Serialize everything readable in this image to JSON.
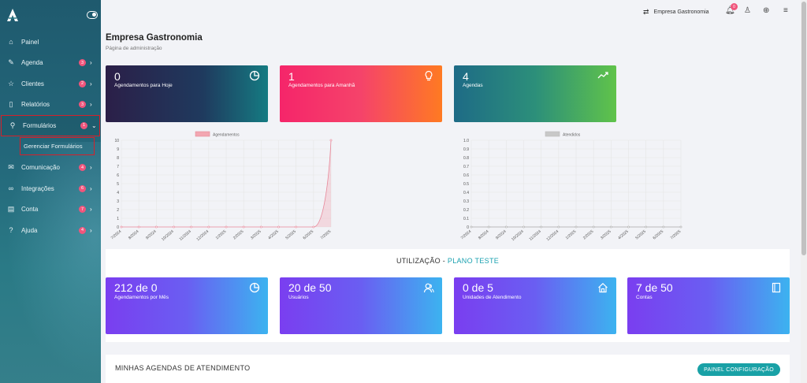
{
  "sidebar": {
    "items": [
      {
        "label": "Painel",
        "icon": "home-icon",
        "badge": "",
        "chevron": ""
      },
      {
        "label": "Agenda",
        "icon": "edit-icon",
        "badge": "3",
        "chevron": "›"
      },
      {
        "label": "Clientes",
        "icon": "star-icon",
        "badge": "2",
        "chevron": "›"
      },
      {
        "label": "Relatórios",
        "icon": "tablet-icon",
        "badge": "3",
        "chevron": "›"
      },
      {
        "label": "Formulários",
        "icon": "search-icon",
        "badge": "1",
        "chevron": "⌄"
      },
      {
        "label": "Comunicação",
        "icon": "mail-icon",
        "badge": "4",
        "chevron": "›"
      },
      {
        "label": "Integrações",
        "icon": "link-icon",
        "badge": "6",
        "chevron": "›"
      },
      {
        "label": "Conta",
        "icon": "briefcase-icon",
        "badge": "7",
        "chevron": "›"
      },
      {
        "label": "Ajuda",
        "icon": "help-icon",
        "badge": "4",
        "chevron": "›"
      }
    ],
    "subitem": "Gerenciar Formulários"
  },
  "topbar": {
    "company": "Empresa Gastronomia",
    "notifications": "0"
  },
  "header": {
    "title": "Empresa Gastronomia",
    "subtitle": "Página de administração"
  },
  "stats": [
    {
      "value": "0",
      "label": "Agendamentos para Hoje",
      "icon": "pie-chart-icon"
    },
    {
      "value": "1",
      "label": "Agendamentos para Amanhã",
      "icon": "lightbulb-icon"
    },
    {
      "value": "4",
      "label": "Agendas",
      "icon": "trend-icon"
    }
  ],
  "chart_data": [
    {
      "type": "area",
      "legend": "Agendamentos",
      "color": "#f3a7b2",
      "categories": [
        "7/2024",
        "8/2024",
        "9/2024",
        "10/2024",
        "11/2024",
        "12/2024",
        "1/2025",
        "2/2025",
        "3/2025",
        "4/2025",
        "5/2025",
        "6/2025",
        "7/2025"
      ],
      "values": [
        0,
        0,
        0,
        0,
        0,
        0,
        0,
        0,
        0,
        0,
        0,
        0,
        10
      ],
      "ylim": [
        0,
        10
      ],
      "yticks": [
        "0",
        "1",
        "2",
        "3",
        "4",
        "5",
        "6",
        "7",
        "8",
        "9",
        "10"
      ],
      "grid": true
    },
    {
      "type": "area",
      "legend": "Atendidos",
      "color": "#c8c8c8",
      "categories": [
        "7/2024",
        "8/2024",
        "9/2024",
        "10/2024",
        "11/2024",
        "12/2024",
        "1/2025",
        "2/2025",
        "3/2025",
        "4/2025",
        "5/2025",
        "6/2025",
        "7/2025"
      ],
      "values": [
        0,
        0,
        0,
        0,
        0,
        0,
        0,
        0,
        0,
        0,
        0,
        0,
        0
      ],
      "ylim": [
        0,
        1
      ],
      "yticks": [
        "0",
        "0.1",
        "0.2",
        "0.3",
        "0.4",
        "0.5",
        "0.6",
        "0.7",
        "0.8",
        "0.9",
        "1.0"
      ],
      "grid": true
    }
  ],
  "util": {
    "title": "UTILIZAÇÃO",
    "separator": "-",
    "plan": "PLANO TESTE",
    "cards": [
      {
        "value": "212 de 0",
        "label": "Agendamentos por Mês",
        "icon": "pie-chart-icon"
      },
      {
        "value": "20 de 50",
        "label": "Usuários",
        "icon": "users-icon"
      },
      {
        "value": "0 de 5",
        "label": "Unidades de Atendimento",
        "icon": "house-icon"
      },
      {
        "value": "7 de 50",
        "label": "Contas",
        "icon": "book-icon"
      }
    ]
  },
  "agendas": {
    "title": "MINHAS AGENDAS DE ATENDIMENTO",
    "button": "PAINEL CONFIGURAÇÃO"
  }
}
